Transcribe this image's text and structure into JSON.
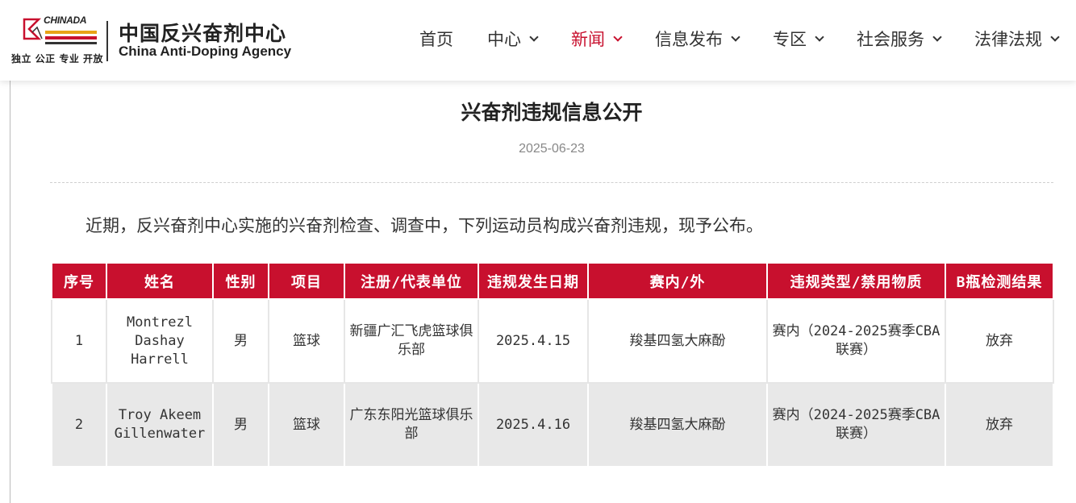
{
  "header": {
    "logo_en_small": "CHINADA",
    "logo_slogan": "独立 公正 专业 开放",
    "logo_cn": "中国反兴奋剂中心",
    "logo_en": "China Anti-Doping Agency",
    "nav": [
      {
        "label": "首页",
        "dropdown": false,
        "active": false
      },
      {
        "label": "中心",
        "dropdown": true,
        "active": false
      },
      {
        "label": "新闻",
        "dropdown": true,
        "active": true
      },
      {
        "label": "信息发布",
        "dropdown": true,
        "active": false
      },
      {
        "label": "专区",
        "dropdown": true,
        "active": false
      },
      {
        "label": "社会服务",
        "dropdown": true,
        "active": false
      },
      {
        "label": "法律法规",
        "dropdown": true,
        "active": false
      }
    ]
  },
  "article": {
    "title": "兴奋剂违规信息公开",
    "date": "2025-06-23",
    "intro": "近期，反兴奋剂中心实施的兴奋剂检查、调查中，下列运动员构成兴奋剂违规，现予公布。"
  },
  "table": {
    "columns": [
      "序号",
      "姓名",
      "性别",
      "项目",
      "注册/代表单位",
      "违规发生日期",
      "赛内/外",
      "违规类型/禁用物质",
      "B瓶检测结果"
    ],
    "rows": [
      [
        "1",
        "Montrezl Dashay Harrell",
        "男",
        "篮球",
        "新疆广汇飞虎篮球俱乐部",
        "2025.4.15",
        "羧基四氢大麻酚",
        "赛内（2024-2025赛季CBA联赛）",
        "放弃"
      ],
      [
        "2",
        "Troy Akeem Gillenwater",
        "男",
        "篮球",
        "广东东阳光篮球俱乐部",
        "2025.4.16",
        "羧基四氢大麻酚",
        "赛内（2024-2025赛季CBA联赛）",
        "放弃"
      ]
    ]
  },
  "colors": {
    "accent": "#c8102e",
    "alt_row": "#e8e8e8"
  }
}
